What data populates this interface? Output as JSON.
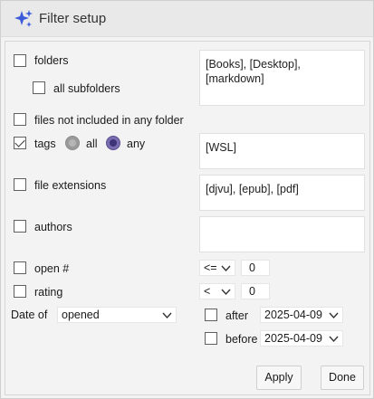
{
  "window": {
    "title": "Filter setup",
    "title_icon": "sparkle-icon",
    "accent": "#3b5bdb"
  },
  "folders": {
    "label": "folders",
    "checked": false,
    "value": "[Books], [Desktop], [markdown]"
  },
  "subfolders": {
    "label": "all subfolders",
    "checked": false
  },
  "unfiled": {
    "label": "files not included in any folder",
    "checked": false
  },
  "tags": {
    "label": "tags",
    "checked": true,
    "radio_all": "all",
    "radio_any": "any",
    "selected": "any",
    "value": "[WSL]"
  },
  "extensions": {
    "label": "file extensions",
    "checked": false,
    "value": "[djvu], [epub], [pdf]"
  },
  "authors": {
    "label": "authors",
    "checked": false,
    "value": ""
  },
  "open_count": {
    "label": "open #",
    "checked": false,
    "operator": "<=",
    "value": "0"
  },
  "rating": {
    "label": "rating",
    "checked": false,
    "operator": "<",
    "value": "0"
  },
  "date": {
    "label": "Date of",
    "field": "opened",
    "after_label": "after",
    "after_checked": false,
    "after_value": "2025-04-09",
    "before_label": "before",
    "before_checked": false,
    "before_value": "2025-04-09"
  },
  "buttons": {
    "apply": "Apply",
    "done": "Done"
  }
}
